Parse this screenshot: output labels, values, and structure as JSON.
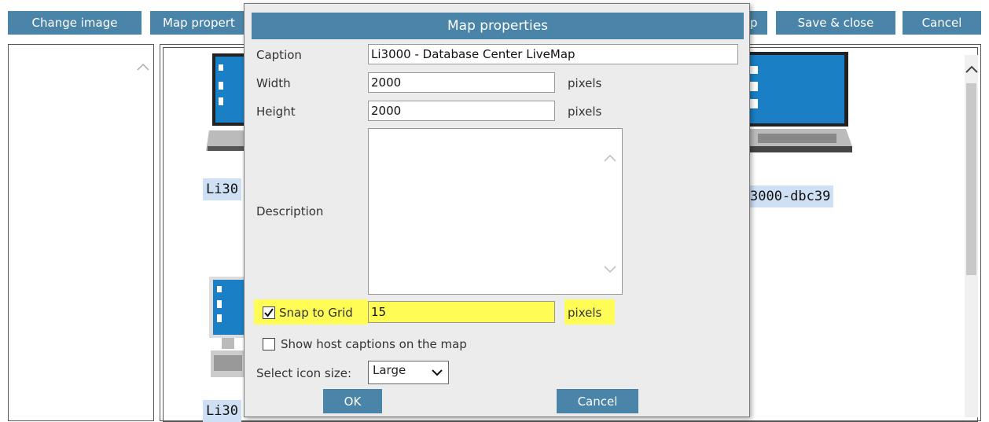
{
  "toolbar": {
    "change_image": "Change image",
    "map_properties": "Map propert",
    "partial_hidden": "p",
    "save_close": "Save & close",
    "cancel": "Cancel"
  },
  "background_hosts": {
    "label_1": "Li30",
    "label_2": "3000-dbc39",
    "label_3": "Li30"
  },
  "dialog": {
    "title": "Map properties",
    "caption_label": "Caption",
    "caption_value": "Li3000 - Database Center LiveMap",
    "width_label": "Width",
    "width_value": "2000",
    "width_unit": "pixels",
    "height_label": "Height",
    "height_value": "2000",
    "height_unit": "pixels",
    "description_label": "Description",
    "description_value": "",
    "snap_label": "Snap to Grid",
    "snap_value": "15",
    "snap_unit": "pixels",
    "snap_checked": true,
    "show_captions_label": "Show host captions on the map",
    "show_captions_checked": false,
    "icon_size_label": "Select icon size:",
    "icon_size_value": "Large",
    "ok_label": "OK",
    "cancel_label": "Cancel"
  },
  "colors": {
    "accent": "#4a84a8",
    "highlight": "#fffd55",
    "label_bg": "#cfe0f5"
  }
}
